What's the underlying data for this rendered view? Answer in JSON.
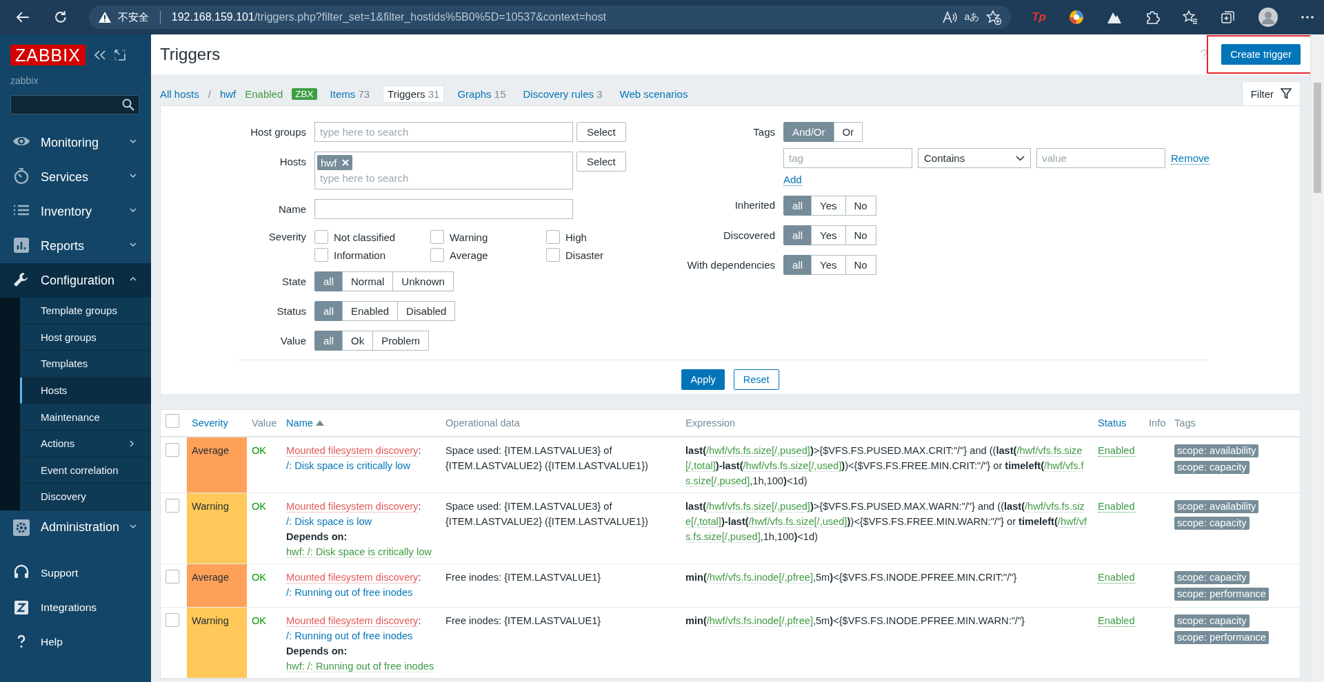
{
  "browser": {
    "warning": "不安全",
    "url_host": "192.168.159.101",
    "url_path": "/triggers.php?filter_set=1&filter_hostids%5B0%5D=10537&context=host",
    "translate_label": "aあ",
    "extension_label": "Tp"
  },
  "sidebar": {
    "logo": "ZABBIX",
    "server_name": "zabbix",
    "menu": [
      {
        "label": "Monitoring",
        "expanded": false
      },
      {
        "label": "Services",
        "expanded": false
      },
      {
        "label": "Inventory",
        "expanded": false
      },
      {
        "label": "Reports",
        "expanded": false
      },
      {
        "label": "Configuration",
        "expanded": true,
        "children": [
          {
            "label": "Template groups",
            "selected": false,
            "submenu": false
          },
          {
            "label": "Host groups",
            "selected": false,
            "submenu": false
          },
          {
            "label": "Templates",
            "selected": false,
            "submenu": false
          },
          {
            "label": "Hosts",
            "selected": true,
            "submenu": false
          },
          {
            "label": "Maintenance",
            "selected": false,
            "submenu": false
          },
          {
            "label": "Actions",
            "selected": false,
            "submenu": true
          },
          {
            "label": "Event correlation",
            "selected": false,
            "submenu": false
          },
          {
            "label": "Discovery",
            "selected": false,
            "submenu": false
          }
        ]
      },
      {
        "label": "Administration",
        "expanded": false
      }
    ],
    "footer": [
      {
        "label": "Support"
      },
      {
        "label": "Integrations"
      },
      {
        "label": "Help"
      }
    ]
  },
  "header": {
    "title": "Triggers",
    "help": "?",
    "create_button": "Create trigger",
    "highlighted": true
  },
  "host_nav": {
    "all_hosts": "All hosts",
    "separator": "/",
    "host": "hwf",
    "status": "Enabled",
    "agent": "ZBX",
    "tabs": [
      {
        "label": "Items",
        "count": "73",
        "selected": false
      },
      {
        "label": "Triggers",
        "count": "31",
        "selected": true
      },
      {
        "label": "Graphs",
        "count": "15",
        "selected": false
      },
      {
        "label": "Discovery rules",
        "count": "3",
        "selected": false
      },
      {
        "label": "Web scenarios",
        "selected": false
      }
    ],
    "filter_tab": "Filter"
  },
  "filter": {
    "host_groups": {
      "label": "Host groups",
      "placeholder": "type here to search",
      "button": "Select"
    },
    "hosts": {
      "label": "Hosts",
      "chips": [
        "hwf"
      ],
      "placeholder": "type here to search",
      "button": "Select"
    },
    "name": {
      "label": "Name"
    },
    "severity": {
      "label": "Severity",
      "options": [
        {
          "label": "Not classified",
          "checked": false
        },
        {
          "label": "Warning",
          "checked": false
        },
        {
          "label": "High",
          "checked": false
        },
        {
          "label": "Information",
          "checked": false
        },
        {
          "label": "Average",
          "checked": false
        },
        {
          "label": "Disaster",
          "checked": false
        }
      ]
    },
    "left_toggles": [
      {
        "label": "State",
        "options": [
          {
            "label": "all",
            "selected": true
          },
          {
            "label": "Normal",
            "selected": false
          },
          {
            "label": "Unknown",
            "selected": false
          }
        ]
      },
      {
        "label": "Status",
        "options": [
          {
            "label": "all",
            "selected": true
          },
          {
            "label": "Enabled",
            "selected": false
          },
          {
            "label": "Disabled",
            "selected": false
          }
        ]
      },
      {
        "label": "Value",
        "options": [
          {
            "label": "all",
            "selected": true
          },
          {
            "label": "Ok",
            "selected": false
          },
          {
            "label": "Problem",
            "selected": false
          }
        ]
      }
    ],
    "tags": {
      "label": "Tags",
      "operator": [
        {
          "label": "And/Or",
          "selected": true
        },
        {
          "label": "Or",
          "selected": false
        }
      ],
      "rows": [
        {
          "tag_placeholder": "tag",
          "operator": "Contains",
          "value_placeholder": "value",
          "remove": "Remove"
        }
      ],
      "add": "Add"
    },
    "right_toggles": [
      {
        "label": "Inherited",
        "options": [
          {
            "label": "all",
            "selected": true
          },
          {
            "label": "Yes",
            "selected": false
          },
          {
            "label": "No",
            "selected": false
          }
        ]
      },
      {
        "label": "Discovered",
        "options": [
          {
            "label": "all",
            "selected": true
          },
          {
            "label": "Yes",
            "selected": false
          },
          {
            "label": "No",
            "selected": false
          }
        ]
      },
      {
        "label": "With dependencies",
        "options": [
          {
            "label": "all",
            "selected": true
          },
          {
            "label": "Yes",
            "selected": false
          },
          {
            "label": "No",
            "selected": false
          }
        ]
      }
    ],
    "apply": "Apply",
    "reset": "Reset"
  },
  "table": {
    "header_checked": false,
    "columns": [
      {
        "label": "Severity",
        "sortable": true,
        "sorted": false
      },
      {
        "label": "Value",
        "sortable": false,
        "sorted": false
      },
      {
        "label": "Name",
        "sortable": true,
        "sorted": true
      },
      {
        "label": "Operational data",
        "sortable": false,
        "sorted": false
      },
      {
        "label": "Expression",
        "sortable": false,
        "sorted": false
      },
      {
        "label": "Status",
        "sortable": true,
        "sorted": false
      },
      {
        "label": "Info",
        "sortable": false,
        "sorted": false
      },
      {
        "label": "Tags",
        "sortable": false,
        "sorted": false
      }
    ],
    "rows": [
      {
        "checked": false,
        "severity": "Average",
        "color": "#ffa059",
        "value": "OK",
        "prefix": "Mounted filesystem discovery",
        "separator": ":",
        "name": "/: Disk space is critically low",
        "operational": "Space used: {ITEM.LASTVALUE3} of {ITEM.LASTVALUE2} ({ITEM.LASTVALUE1})",
        "expression": [
          {
            "kind": "op",
            "text": "last("
          },
          {
            "kind": "key",
            "text": "/hwf/vfs.fs.size[/,pused]"
          },
          {
            "kind": "op",
            "text": ")"
          },
          {
            "kind": "text",
            "text": ">{$VFS.FS.PUSED.MAX.CRIT:\"/\"} and (("
          },
          {
            "kind": "op",
            "text": "last("
          },
          {
            "kind": "key",
            "text": "/hwf/vfs.fs.size[/,total]"
          },
          {
            "kind": "op",
            "text": ")-last("
          },
          {
            "kind": "key",
            "text": "/hwf/vfs.fs.size[/,used]"
          },
          {
            "kind": "op",
            "text": ")"
          },
          {
            "kind": "text",
            "text": ")<{$VFS.FS.FREE.MIN.CRIT:\"/\"} or "
          },
          {
            "kind": "op",
            "text": "timeleft("
          },
          {
            "kind": "key",
            "text": "/hwf/vfs.fs.size[/,pused]"
          },
          {
            "kind": "text",
            "text": ",1h,100"
          },
          {
            "kind": "op",
            "text": ")"
          },
          {
            "kind": "text",
            "text": "<1d)"
          }
        ],
        "status": "Enabled",
        "enabled": true,
        "tags": [
          "scope: availability",
          "scope: capacity"
        ]
      },
      {
        "checked": false,
        "severity": "Warning",
        "color": "#ffc859",
        "value": "OK",
        "prefix": "Mounted filesystem discovery",
        "separator": ":",
        "name": "/: Disk space is low",
        "depends_label": "Depends on:",
        "depends": "hwf: /: Disk space is critically low",
        "operational": "Space used: {ITEM.LASTVALUE3} of {ITEM.LASTVALUE2} ({ITEM.LASTVALUE1})",
        "expression": [
          {
            "kind": "op",
            "text": "last("
          },
          {
            "kind": "key",
            "text": "/hwf/vfs.fs.size[/,pused]"
          },
          {
            "kind": "op",
            "text": ")"
          },
          {
            "kind": "text",
            "text": ">{$VFS.FS.PUSED.MAX.WARN:\"/\"} and (("
          },
          {
            "kind": "op",
            "text": "last("
          },
          {
            "kind": "key",
            "text": "/hwf/vfs.fs.size[/,total]"
          },
          {
            "kind": "op",
            "text": ")-last("
          },
          {
            "kind": "key",
            "text": "/hwf/vfs.fs.size[/,used]"
          },
          {
            "kind": "op",
            "text": ")"
          },
          {
            "kind": "text",
            "text": ")<{$VFS.FS.FREE.MIN.WARN:\"/\"} or "
          },
          {
            "kind": "op",
            "text": "timeleft("
          },
          {
            "kind": "key",
            "text": "/hwf/vfs.fs.size[/,pused]"
          },
          {
            "kind": "text",
            "text": ",1h,100"
          },
          {
            "kind": "op",
            "text": ")"
          },
          {
            "kind": "text",
            "text": "<1d)"
          }
        ],
        "status": "Enabled",
        "enabled": true,
        "tags": [
          "scope: availability",
          "scope: capacity"
        ]
      },
      {
        "checked": false,
        "severity": "Average",
        "color": "#ffa059",
        "value": "OK",
        "prefix": "Mounted filesystem discovery",
        "separator": ":",
        "name": "/: Running out of free inodes",
        "operational": "Free inodes: {ITEM.LASTVALUE1}",
        "expression": [
          {
            "kind": "op",
            "text": "min("
          },
          {
            "kind": "key",
            "text": "/hwf/vfs.fs.inode[/,pfree]"
          },
          {
            "kind": "text",
            "text": ",5m"
          },
          {
            "kind": "op",
            "text": ")"
          },
          {
            "kind": "text",
            "text": "<{$VFS.FS.INODE.PFREE.MIN.CRIT:\"/\"}"
          }
        ],
        "status": "Enabled",
        "enabled": true,
        "tags": [
          "scope: capacity",
          "scope: performance"
        ]
      },
      {
        "checked": false,
        "severity": "Warning",
        "color": "#ffc859",
        "value": "OK",
        "prefix": "Mounted filesystem discovery",
        "separator": ":",
        "name": "/: Running out of free inodes",
        "depends_label": "Depends on:",
        "depends": "hwf: /: Running out of free inodes",
        "operational": "Free inodes: {ITEM.LASTVALUE1}",
        "expression": [
          {
            "kind": "op",
            "text": "min("
          },
          {
            "kind": "key",
            "text": "/hwf/vfs.fs.inode[/,pfree]"
          },
          {
            "kind": "text",
            "text": ",5m"
          },
          {
            "kind": "op",
            "text": ")"
          },
          {
            "kind": "text",
            "text": "<{$VFS.FS.INODE.PFREE.MIN.WARN:\"/\"}"
          }
        ],
        "status": "Enabled",
        "enabled": true,
        "tags": [
          "scope: capacity",
          "scope: performance"
        ]
      }
    ]
  }
}
